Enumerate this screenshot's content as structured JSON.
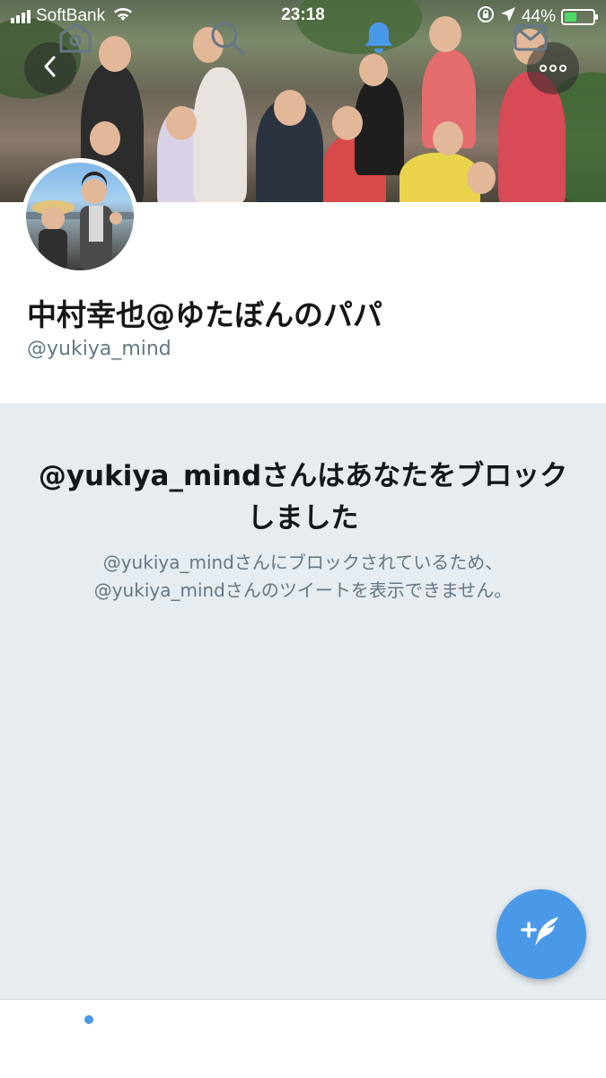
{
  "status_bar": {
    "carrier": "SoftBank",
    "time": "23:18",
    "battery_percent": "44%",
    "battery_level": 0.44,
    "icons": [
      "signal-icon",
      "wifi-icon",
      "orientation-lock-icon",
      "location-icon",
      "battery-icon"
    ]
  },
  "header": {
    "back_icon": "chevron-left-icon",
    "more_icon": "more-horizontal-icon"
  },
  "profile": {
    "display_name": "中村幸也@ゆたぼんのパパ",
    "handle": "@yukiya_mind"
  },
  "blocked": {
    "title": "@yukiya_mindさんはあなたをブロックしました",
    "description_line1": "@yukiya_mindさんにブロックされているため、",
    "description_line2": "@yukiya_mindさんのツイートを表示できません。"
  },
  "compose_button": {
    "icon": "compose-tweet-icon"
  },
  "tab_bar": {
    "tabs": [
      {
        "name": "home",
        "icon": "home-icon",
        "active": false,
        "has_badge": true
      },
      {
        "name": "search",
        "icon": "search-icon",
        "active": false
      },
      {
        "name": "notifications",
        "icon": "bell-icon",
        "active": true
      },
      {
        "name": "messages",
        "icon": "mail-icon",
        "active": false
      }
    ]
  },
  "colors": {
    "accent": "#4a99e9",
    "text_primary": "#14171a",
    "text_secondary": "#657786",
    "blocked_background": "#e6ecf0"
  }
}
